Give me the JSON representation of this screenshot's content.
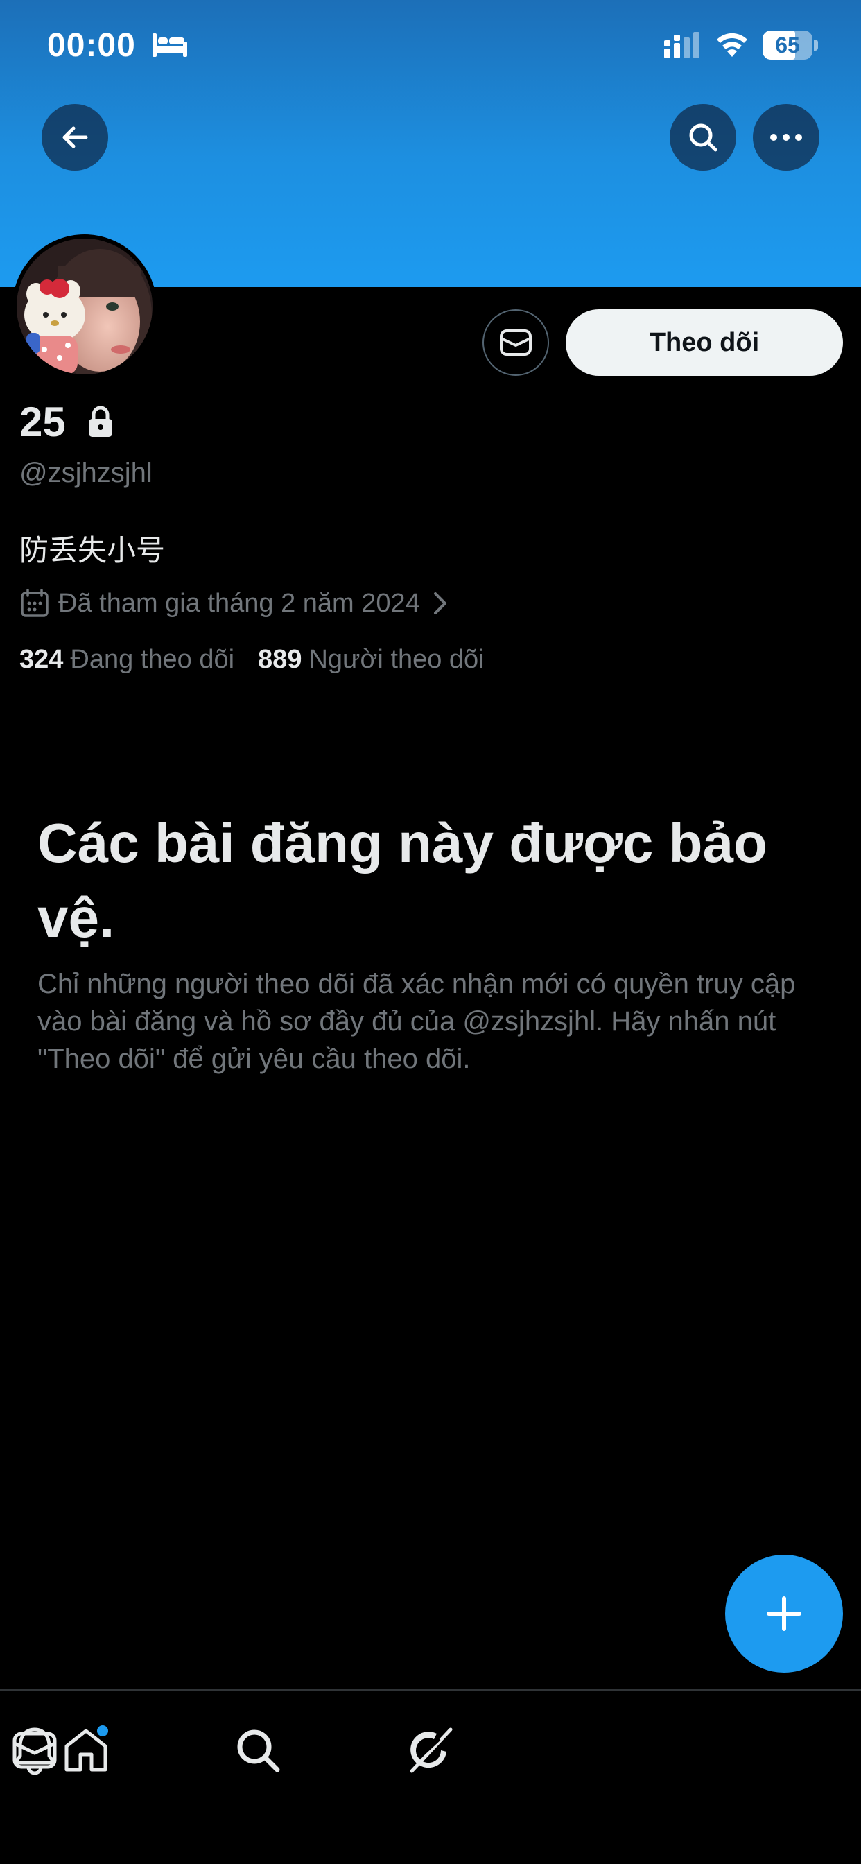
{
  "status_bar": {
    "time": "00:00",
    "battery_level": "65",
    "battery_fraction": 0.65
  },
  "header": {
    "back_icon": "arrow-left-icon",
    "search_icon": "search-icon",
    "more_icon": "more-horizontal-icon"
  },
  "profile": {
    "display_name": "25",
    "handle": "@zsjhzsjhl",
    "bio": "防丢失小号",
    "joined": "Đã tham gia tháng 2 năm 2024",
    "following_count": "324",
    "following_label": "Đang theo dõi",
    "followers_count": "889",
    "followers_label": "Người theo dõi",
    "follow_button_label": "Theo dõi",
    "message_icon": "mail-icon"
  },
  "protected": {
    "title": "Các bài đăng này được bảo vệ.",
    "description": "Chỉ những người theo dõi đã xác nhận mới có quyền truy cập vào bài đăng và hồ sơ đầy đủ của @zsjhzsjhl. Hãy nhấn nút \"Theo dõi\" để gửi yêu cầu theo dõi."
  },
  "bottom_nav": {
    "items": [
      "home-icon",
      "search-icon",
      "grok-icon",
      "bell-icon",
      "mail-icon"
    ]
  },
  "colors": {
    "accent": "#1d9bf0",
    "background": "#000000",
    "text_primary": "#e7e9ea",
    "text_secondary": "#71767b"
  }
}
